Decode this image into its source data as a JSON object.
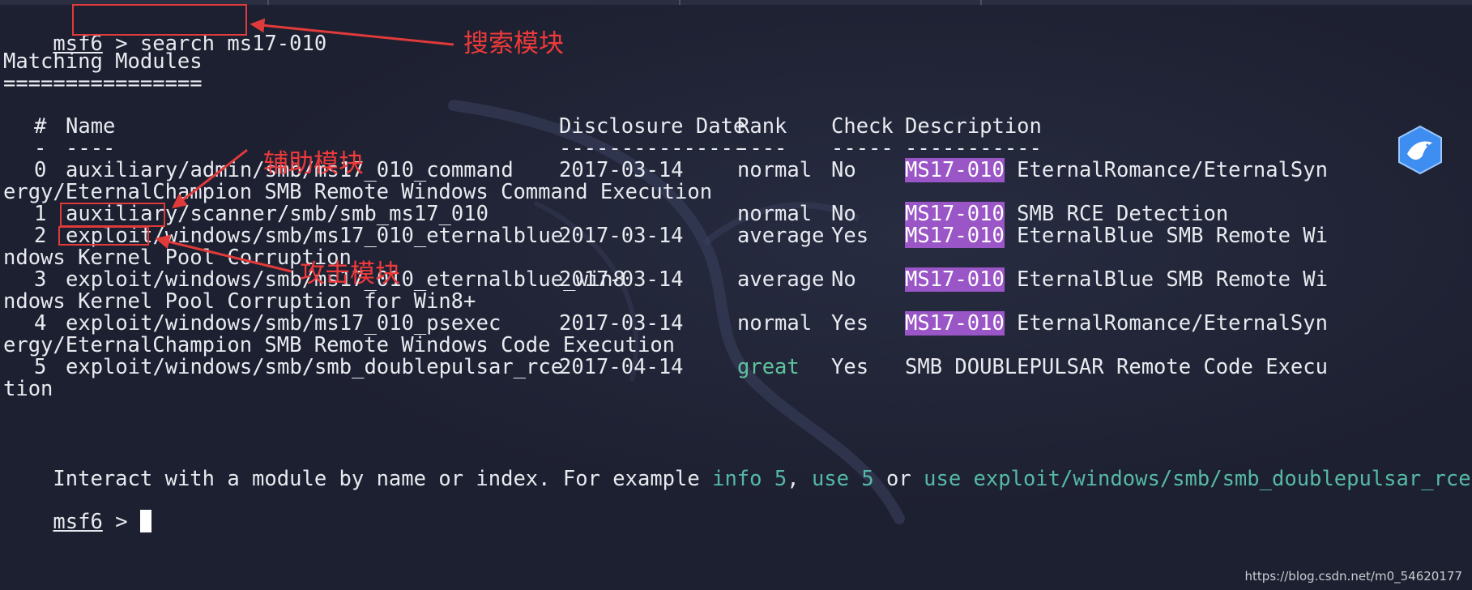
{
  "prompt": {
    "name": "msf6",
    "separator": " > "
  },
  "command": "search ms17-010",
  "heading": {
    "title": "Matching Modules",
    "underline": "================"
  },
  "table": {
    "headers": {
      "index": "#",
      "name": "Name",
      "date": "Disclosure Date",
      "rank": "Rank",
      "check": "Check",
      "description": "Description"
    },
    "dividers": {
      "index": "-",
      "name": "----",
      "date": "---------------",
      "rank": "----",
      "check": "-----",
      "description": "-----------"
    },
    "rows": [
      {
        "index": "0",
        "name": "auxiliary/admin/smb/ms17_010_command",
        "date": "2017-03-14",
        "rank": "normal",
        "check": "No",
        "tag": "MS17-010",
        "desc_line1": " EternalRomance/EternalSyn",
        "desc_line2": "ergy/EternalChampion SMB Remote Windows Command Execution"
      },
      {
        "index": "1",
        "name_prefix": "auxiliary",
        "name_rest": "/scanner/smb/smb_ms17_010",
        "date": "",
        "rank": "normal",
        "check": "No",
        "tag": "MS17-010",
        "desc_line1": " SMB RCE Detection",
        "desc_line2": ""
      },
      {
        "index": "2",
        "name_prefix": "exploit",
        "name_rest": "/windows/smb/ms17_010_eternalblue",
        "date": "2017-03-14",
        "rank": "average",
        "check": "Yes",
        "tag": "MS17-010",
        "desc_line1": " EternalBlue SMB Remote Wi",
        "desc_line2": "ndows Kernel Pool Corruption"
      },
      {
        "index": "3",
        "name": "exploit/windows/smb/ms17_010_eternalblue_win8",
        "date": "2017-03-14",
        "rank": "average",
        "check": "No",
        "tag": "MS17-010",
        "desc_line1": " EternalBlue SMB Remote Wi",
        "desc_line2": "ndows Kernel Pool Corruption for Win8+"
      },
      {
        "index": "4",
        "name": "exploit/windows/smb/ms17_010_psexec",
        "date": "2017-03-14",
        "rank": "normal",
        "check": "Yes",
        "tag": "MS17-010",
        "desc_line1": " EternalRomance/EternalSyn",
        "desc_line2": "ergy/EternalChampion SMB Remote Windows Code Execution"
      },
      {
        "index": "5",
        "name": "exploit/windows/smb/smb_doublepulsar_rce",
        "date": "2017-04-14",
        "rank": "great",
        "check": "Yes",
        "tag": "",
        "desc_line1": "SMB DOUBLEPULSAR Remote Code Execu",
        "desc_line2": "tion"
      }
    ]
  },
  "hint": {
    "text1": "Interact with a module by name or index. For example ",
    "cmd1": "info 5",
    "text2": ", ",
    "cmd2": "use 5",
    "text3": " or ",
    "cmd3": "use exploit/windows/smb/smb_doublepulsar_rce"
  },
  "annotations": {
    "search_module": "搜索模块",
    "auxiliary_module": "辅助模块",
    "attack_module": "攻击模块"
  },
  "watermark_url": "https://blog.csdn.net/m0_54620177",
  "colors": {
    "background": "#1d2030",
    "highlight": "#9a55c6",
    "annotation_red": "#e03a3a",
    "teal": "#56b9a6"
  }
}
